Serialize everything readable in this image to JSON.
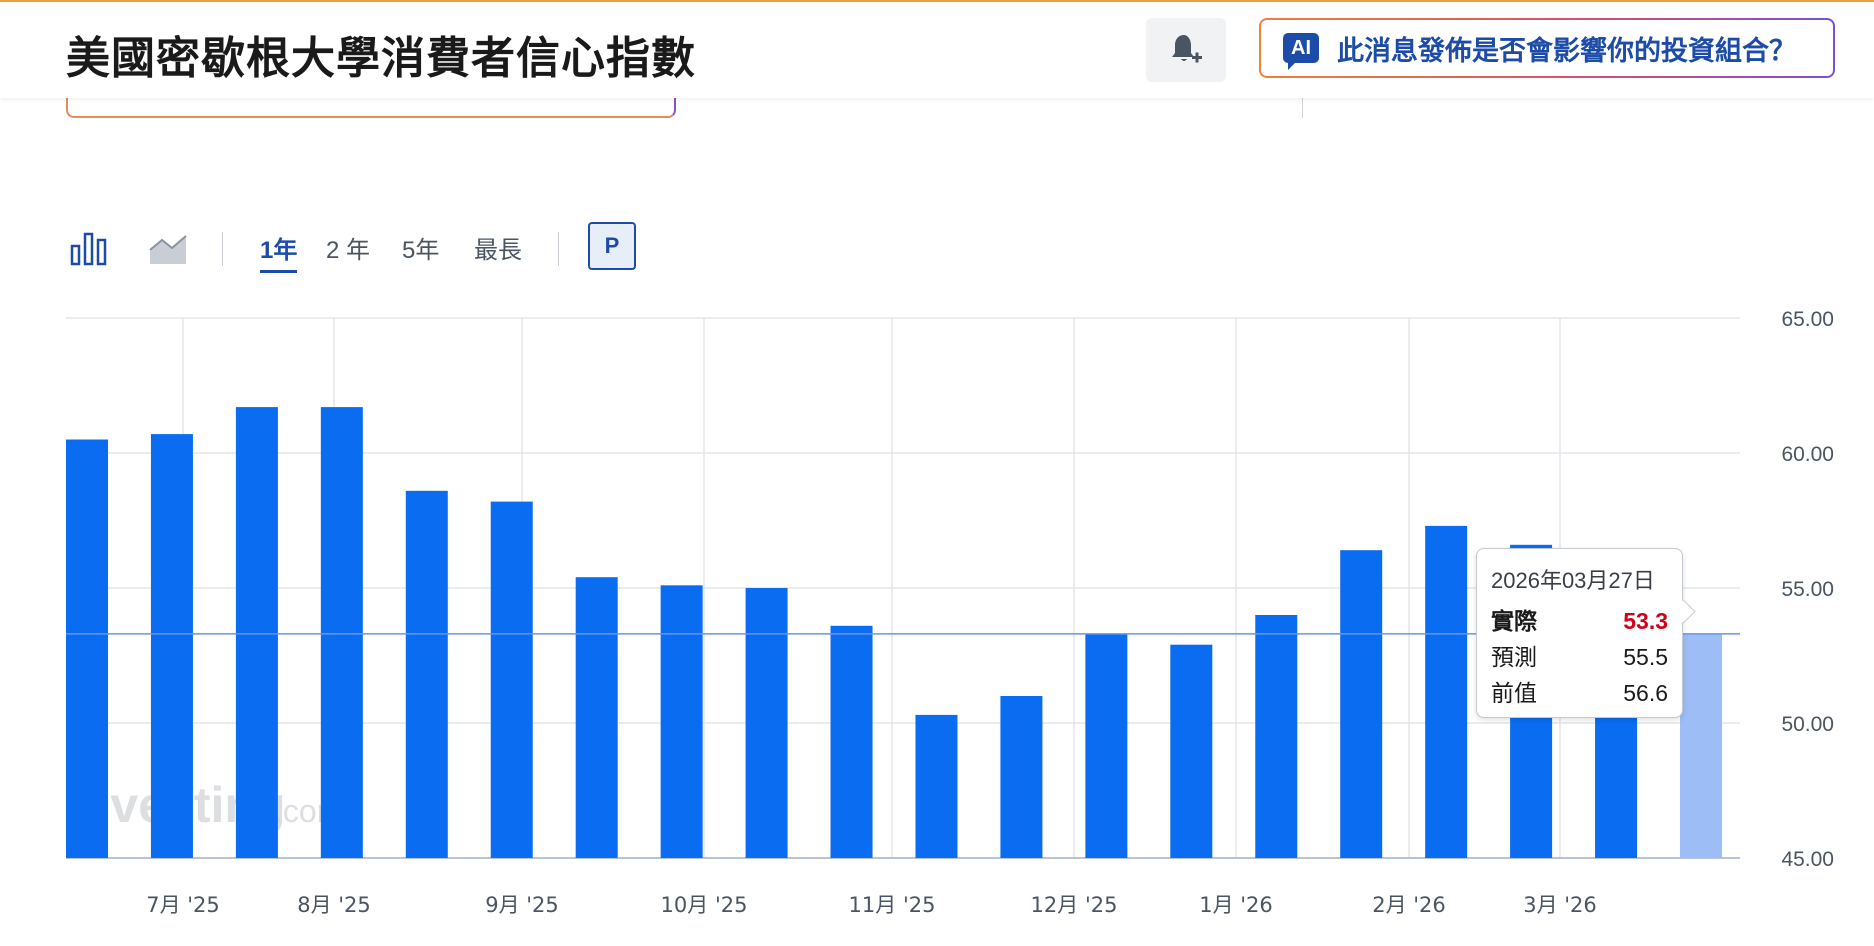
{
  "header": {
    "title": "美國密歇根大學消費者信心指數",
    "ai_label": "此消息發佈是否會影響你的投資組合？",
    "ai_badge": "AI"
  },
  "toolbar": {
    "ranges": [
      "1年",
      "2 年",
      "5年",
      "最長"
    ],
    "active_range": "1年",
    "p_label": "P"
  },
  "colors": {
    "bar": "#0A6CF0",
    "bar_pending": "#9CBDF5",
    "accent": "#1C4BA8",
    "actual_value": "#D0021B"
  },
  "tooltip": {
    "date": "2026年03月27日",
    "rows": [
      {
        "label": "實際",
        "value": "53.3"
      },
      {
        "label": "預測",
        "value": "55.5"
      },
      {
        "label": "前值",
        "value": "56.6"
      }
    ]
  },
  "chart_data": {
    "type": "bar",
    "ylim": [
      45,
      65
    ],
    "y_ticks": [
      "65.00",
      "60.00",
      "55.00",
      "50.00",
      "45.00"
    ],
    "y_axis_position": "right",
    "grid": true,
    "reference_line": 53.3,
    "month_labels": [
      "7月 '25",
      "8月 '25",
      "9月 '25",
      "10月 '25",
      "11月 '25",
      "12月 '25",
      "1月 '26",
      "2月 '26",
      "3月 '26"
    ],
    "values": [
      60.5,
      60.7,
      61.7,
      61.7,
      58.6,
      58.2,
      55.4,
      55.1,
      55.0,
      53.6,
      50.3,
      51.0,
      53.3,
      52.9,
      54.0,
      56.4,
      57.3,
      56.6,
      55.5,
      53.3
    ],
    "pending_last": true,
    "watermark": "Investing.com"
  }
}
